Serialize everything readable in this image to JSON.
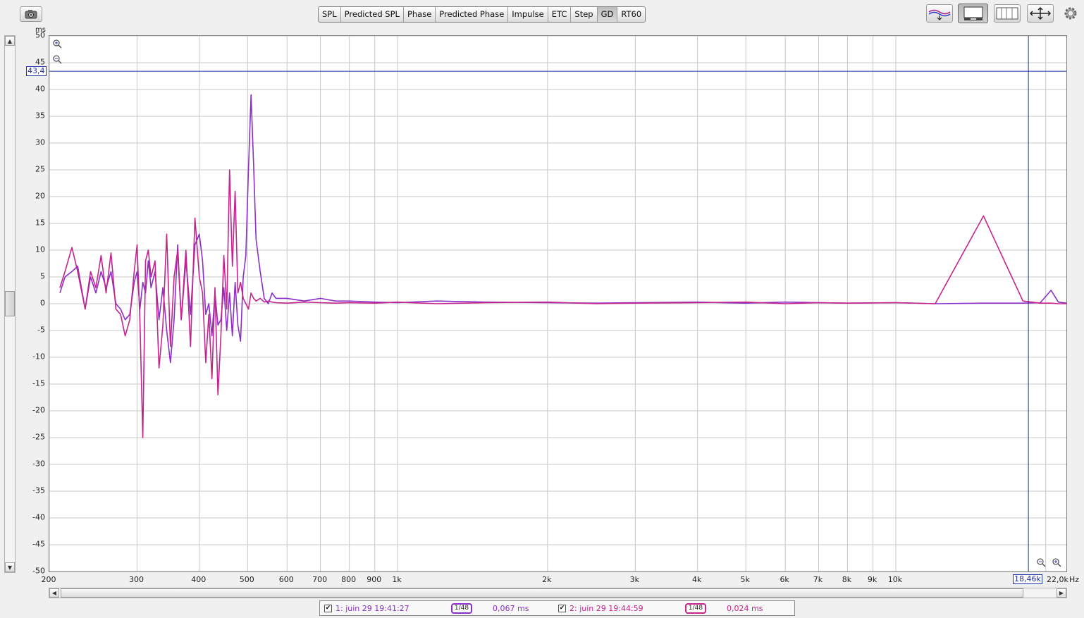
{
  "toolbar": {
    "camera_icon": "camera-icon",
    "tabs": [
      {
        "label": "SPL"
      },
      {
        "label": "Predicted SPL"
      },
      {
        "label": "Phase"
      },
      {
        "label": "Predicted Phase"
      },
      {
        "label": "Impulse"
      },
      {
        "label": "ETC"
      },
      {
        "label": "Step"
      },
      {
        "label": "GD",
        "active": true
      },
      {
        "label": "RT60"
      }
    ],
    "right_tools": [
      "traces-icon",
      "controls-panel-icon",
      "graph-layout-icon",
      "zoom-fit-icon",
      "gear-icon"
    ]
  },
  "plot": {
    "y_unit": "ms",
    "x_unit": "Hz",
    "cursor_y_label": "43,4",
    "cursor_x_label": "18,46k",
    "x_end_label": "22,0k"
  },
  "colors": {
    "trace1": "#8b2fc9",
    "trace2": "#c4248c",
    "cursor": "#1f2fa8",
    "grid": "#c8c8c8"
  },
  "chart_data": {
    "type": "line",
    "xscale": "log",
    "xlim": [
      200,
      22000
    ],
    "ylim": [
      -50,
      50
    ],
    "y_ticks": [
      50,
      45,
      40,
      35,
      30,
      25,
      20,
      15,
      10,
      5,
      0,
      -5,
      -10,
      -15,
      -20,
      -25,
      -30,
      -35,
      -40,
      -45,
      -50
    ],
    "x_ticks": [
      {
        "value": 200,
        "label": "200"
      },
      {
        "value": 300,
        "label": "300"
      },
      {
        "value": 400,
        "label": "400"
      },
      {
        "value": 500,
        "label": "500"
      },
      {
        "value": 600,
        "label": "600"
      },
      {
        "value": 700,
        "label": "700"
      },
      {
        "value": 800,
        "label": "800"
      },
      {
        "value": 900,
        "label": "900"
      },
      {
        "value": 1000,
        "label": "1k"
      },
      {
        "value": 2000,
        "label": "2k"
      },
      {
        "value": 3000,
        "label": "3k"
      },
      {
        "value": 4000,
        "label": "4k"
      },
      {
        "value": 5000,
        "label": "5k"
      },
      {
        "value": 6000,
        "label": "6k"
      },
      {
        "value": 7000,
        "label": "7k"
      },
      {
        "value": 8000,
        "label": "8k"
      },
      {
        "value": 9000,
        "label": "9k"
      },
      {
        "value": 10000,
        "label": "10k"
      }
    ],
    "grid": true,
    "cursor": {
      "x": 18460,
      "y": 43.4
    },
    "series": [
      {
        "x": [
          210,
          215,
          222,
          228,
          236,
          242,
          248,
          254,
          260,
          266,
          272,
          278,
          284,
          290,
          296,
          300,
          304,
          308,
          312,
          316,
          320,
          326,
          332,
          338,
          344,
          350,
          356,
          362,
          368,
          376,
          384,
          392,
          400,
          406,
          412,
          418,
          424,
          430,
          436,
          442,
          448,
          454,
          460,
          466,
          472,
          478,
          484,
          490,
          496,
          502,
          508,
          514,
          520,
          530,
          540,
          550,
          560,
          570,
          600,
          650,
          700,
          750,
          800,
          900,
          1000,
          1200,
          1500,
          2000,
          2500,
          3000,
          4000,
          5000,
          6000,
          7000,
          8000,
          10000,
          12000,
          15000,
          18000,
          19500,
          20500,
          21200,
          22000
        ],
        "values": [
          2,
          5,
          6,
          7,
          -1,
          5,
          2,
          6,
          3,
          6,
          0,
          -1,
          -3,
          -2,
          4,
          6,
          -1,
          4,
          2,
          8,
          3,
          6,
          -3,
          3,
          -5,
          -11,
          -3,
          11,
          -3,
          8,
          -2,
          11,
          13,
          8,
          -2,
          0,
          -6,
          2,
          -4,
          -3,
          3,
          -5,
          2,
          -6,
          4,
          -4,
          -7,
          5,
          9,
          25,
          39,
          26,
          12,
          6,
          1,
          0,
          2,
          1,
          1,
          0.5,
          1,
          0.5,
          0.5,
          0.3,
          0.2,
          0.5,
          0.3,
          0.2,
          0.1,
          0.2,
          0.3,
          0.1,
          0.3,
          0.2,
          0.1,
          0.2,
          0,
          0.1,
          0.1,
          0.2,
          2.5,
          0.3,
          0.1
        ]
      },
      {
        "x": [
          210,
          215,
          222,
          228,
          236,
          242,
          248,
          254,
          260,
          266,
          272,
          278,
          284,
          290,
          296,
          300,
          304,
          308,
          312,
          316,
          320,
          326,
          332,
          338,
          344,
          350,
          356,
          362,
          368,
          376,
          384,
          392,
          400,
          406,
          412,
          418,
          424,
          430,
          436,
          442,
          448,
          454,
          460,
          466,
          472,
          478,
          484,
          490,
          496,
          502,
          508,
          514,
          520,
          530,
          540,
          550,
          560,
          570,
          600,
          650,
          700,
          750,
          800,
          900,
          1000,
          1200,
          1500,
          2000,
          2500,
          3000,
          4000,
          5000,
          6000,
          7000,
          8000,
          10000,
          12000,
          15000,
          18000,
          19500,
          20500,
          21200,
          22000
        ],
        "values": [
          3,
          6,
          10.5,
          6,
          -1,
          6,
          3,
          9,
          2,
          9.5,
          -1,
          -2,
          -6,
          -3,
          6,
          11,
          -3,
          -25,
          8,
          10,
          5,
          8,
          -12,
          -4,
          13,
          -8,
          5,
          10,
          -3,
          10,
          -8,
          16,
          5,
          2,
          -11,
          -2,
          -14,
          3,
          -17,
          -6,
          9,
          -1,
          25,
          7,
          21,
          2,
          4,
          1,
          0,
          -1,
          2,
          1,
          0.5,
          1,
          0.3,
          0.5,
          0.3,
          0.2,
          0.1,
          0.3,
          0.2,
          0.1,
          0.2,
          0.1,
          0.3,
          0,
          0.2,
          0.3,
          0,
          0.1,
          0.2,
          0.3,
          0,
          0.2,
          0.1,
          0.2,
          0,
          16.4,
          0.5,
          0.1,
          0.1,
          0,
          0
        ]
      }
    ]
  },
  "legend": {
    "items": [
      {
        "checked": "✔",
        "label": "1: juin 29 19:41:27",
        "smoothing": "1/48",
        "value": "0,067 ms"
      },
      {
        "checked": "✔",
        "label": "2: juin 29 19:44:59",
        "smoothing": "1/48",
        "value": "0,024 ms"
      }
    ]
  }
}
